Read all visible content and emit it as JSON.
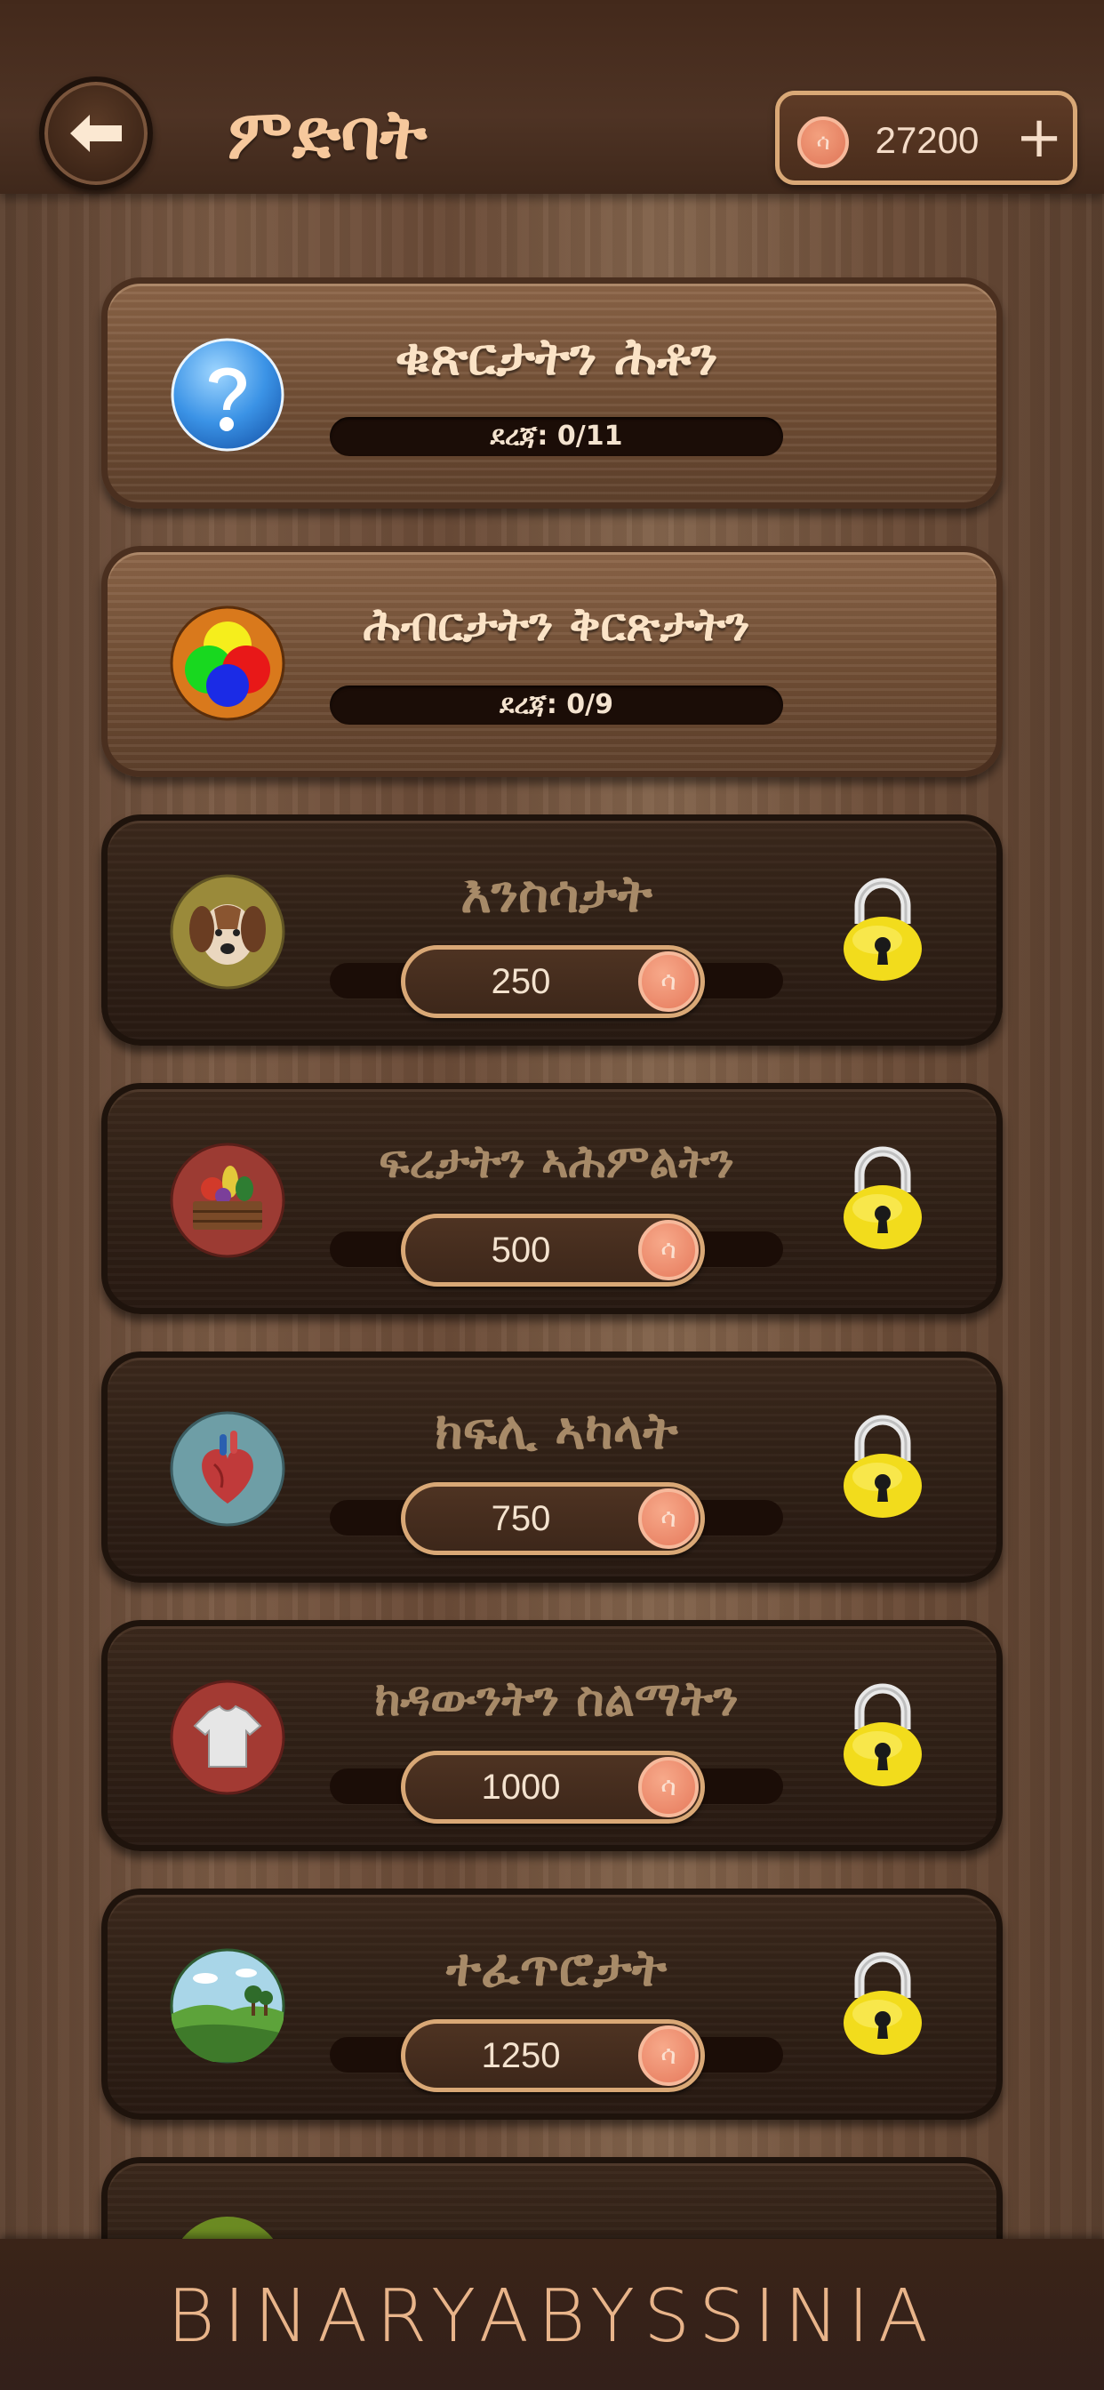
{
  "header": {
    "title": "ምድባት",
    "coins": "27200",
    "plus_label": "+",
    "coin_symbol": "ሳ"
  },
  "categories": [
    {
      "title": "ቁጽርታትን ሕቶን",
      "level": "ደረጃ: 0/11",
      "status": "open",
      "icon": "question-icon"
    },
    {
      "title": "ሕብርታትን ቅርጽታትን",
      "level": "ደረጃ: 0/9",
      "status": "open",
      "icon": "colors-icon"
    },
    {
      "title": "እንስሳታት",
      "price": "250",
      "status": "locked",
      "icon": "dog-icon"
    },
    {
      "title": "ፍረታትን ኣሕምልትን",
      "price": "500",
      "status": "locked",
      "icon": "fruit-basket-icon"
    },
    {
      "title": "ክፍሊ ኣካላት",
      "price": "750",
      "status": "locked",
      "icon": "heart-organ-icon"
    },
    {
      "title": "ክዳውንትን ስልማትን",
      "price": "1000",
      "status": "locked",
      "icon": "tshirt-icon"
    },
    {
      "title": "ተፈጥሮታት",
      "price": "1250",
      "status": "locked",
      "icon": "landscape-icon"
    }
  ],
  "footer": {
    "brand": "BINARYABYSSINIA"
  },
  "colors": {
    "title": "#f6c89c",
    "coin": "#e67a5c",
    "lock": "#f2dc1c",
    "border_gold": "#d9a876"
  }
}
